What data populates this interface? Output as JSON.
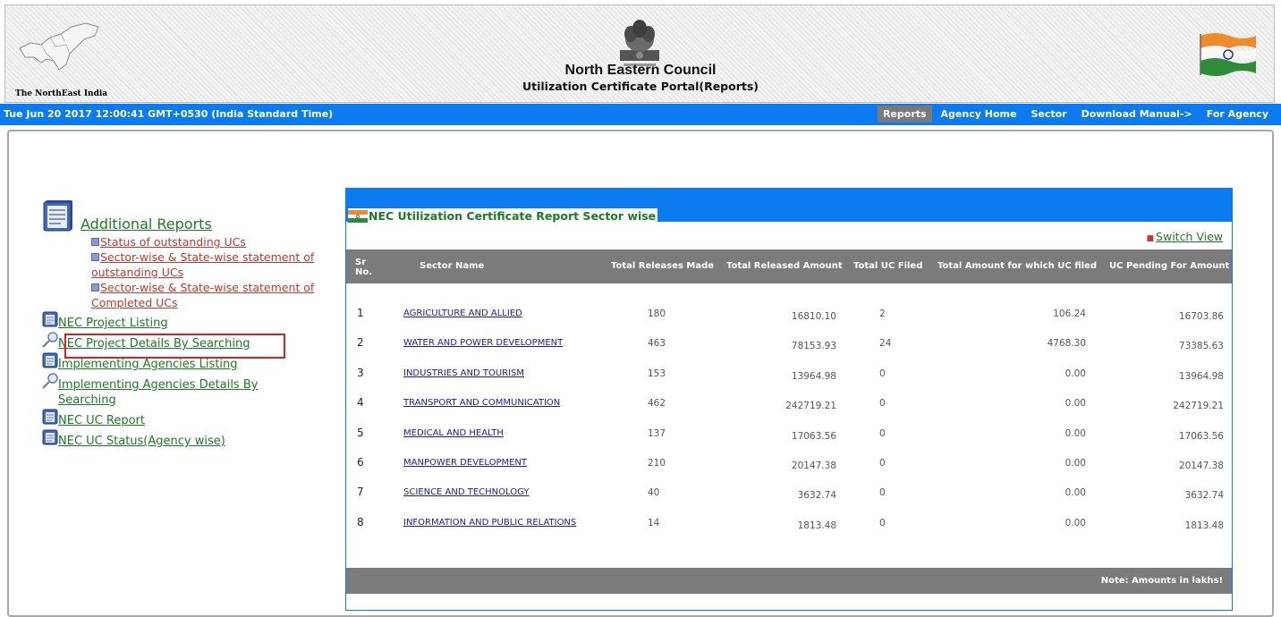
{
  "header": {
    "region_caption": "The NorthEast India",
    "title": "North Eastern Council",
    "subtitle": "Utilization Certificate Portal(Reports)"
  },
  "navbar": {
    "datetime": "Tue Jun 20 2017 12:00:41 GMT+0530 (India Standard Time)",
    "links": [
      "Reports",
      "Agency Home",
      "Sector",
      "Download Manual->",
      "For Agency"
    ],
    "active_link": "Reports",
    "color": "#0d7bf0"
  },
  "sidebar": {
    "additional_reports": "Additional Reports",
    "sublinks": [
      "Status of outstanding UCs",
      "Sector-wise & State-wise statement of outstanding UCs",
      "Sector-wise & State-wise statement of Completed UCs"
    ],
    "nav_items": [
      {
        "label": "NEC Project Listing",
        "icon": "document-icon"
      },
      {
        "label": "NEC Project Details By Searching",
        "icon": "magnifier-icon"
      },
      {
        "label": "Implementing Agencies Listing",
        "icon": "document-icon"
      },
      {
        "label": "Implementing Agencies Details By Searching",
        "icon": "magnifier-icon"
      },
      {
        "label": "NEC UC Report",
        "icon": "document-icon"
      },
      {
        "label": "NEC UC Status(Agency wise)",
        "icon": "document-icon"
      }
    ]
  },
  "report": {
    "title": "NEC Utilization Certificate Report Sector wise",
    "switch_view": "Switch View",
    "columns": {
      "sr": "Sr No.",
      "sector": "Sector Name",
      "releases": "Total Releases Made",
      "released_amount": "Total Released Amount",
      "uc_filed": "Total UC Filed",
      "uc_amount": "Total Amount for which UC filed",
      "pending": "UC Pending For Amount"
    },
    "rows": [
      {
        "sr": "1",
        "sector": "AGRICULTURE AND ALLIED",
        "releases": "180",
        "released_amount": "16810.10",
        "uc_filed": "2",
        "uc_amount": "106.24",
        "pending": "16703.86"
      },
      {
        "sr": "2",
        "sector": "WATER AND POWER DEVELOPMENT",
        "releases": "463",
        "released_amount": "78153.93",
        "uc_filed": "24",
        "uc_amount": "4768.30",
        "pending": "73385.63"
      },
      {
        "sr": "3",
        "sector": "INDUSTRIES AND TOURISM",
        "releases": "153",
        "released_amount": "13964.98",
        "uc_filed": "0",
        "uc_amount": "0.00",
        "pending": "13964.98"
      },
      {
        "sr": "4",
        "sector": "TRANSPORT AND COMMUNICATION",
        "releases": "462",
        "released_amount": "242719.21",
        "uc_filed": "0",
        "uc_amount": "0.00",
        "pending": "242719.21"
      },
      {
        "sr": "5",
        "sector": "MEDICAL AND HEALTH",
        "releases": "137",
        "released_amount": "17063.56",
        "uc_filed": "0",
        "uc_amount": "0.00",
        "pending": "17063.56"
      },
      {
        "sr": "6",
        "sector": "MANPOWER DEVELOPMENT",
        "releases": "210",
        "released_amount": "20147.38",
        "uc_filed": "0",
        "uc_amount": "0.00",
        "pending": "20147.38"
      },
      {
        "sr": "7",
        "sector": "SCIENCE AND TECHNOLOGY",
        "releases": "40",
        "released_amount": "3632.74",
        "uc_filed": "0",
        "uc_amount": "0.00",
        "pending": "3632.74"
      },
      {
        "sr": "8",
        "sector": "INFORMATION AND PUBLIC RELATIONS",
        "releases": "14",
        "released_amount": "1813.48",
        "uc_filed": "0",
        "uc_amount": "0.00",
        "pending": "1813.48"
      }
    ],
    "footer_note": "Note: Amounts in lakhs!"
  }
}
